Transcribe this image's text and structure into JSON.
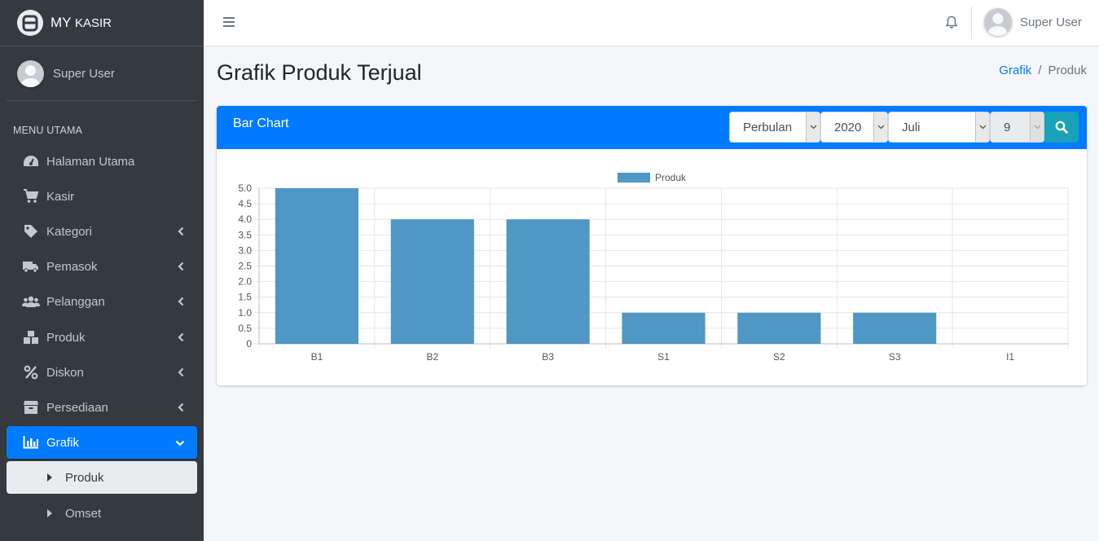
{
  "brand": {
    "name_main": "MY",
    "name_small": "KASIR"
  },
  "sidebar": {
    "user_name": "Super User",
    "menu_header": "MENU UTAMA",
    "items": [
      {
        "label": "Halaman Utama",
        "icon": "dashboard-icon",
        "has_children": false
      },
      {
        "label": "Kasir",
        "icon": "cart-icon",
        "has_children": false
      },
      {
        "label": "Kategori",
        "icon": "tag-icon",
        "has_children": true
      },
      {
        "label": "Pemasok",
        "icon": "truck-icon",
        "has_children": true
      },
      {
        "label": "Pelanggan",
        "icon": "users-icon",
        "has_children": true
      },
      {
        "label": "Produk",
        "icon": "boxes-icon",
        "has_children": true
      },
      {
        "label": "Diskon",
        "icon": "percent-icon",
        "has_children": true
      },
      {
        "label": "Persediaan",
        "icon": "box-icon",
        "has_children": true
      },
      {
        "label": "Grafik",
        "icon": "chart-bar-icon",
        "has_children": true,
        "active": true
      }
    ],
    "sub_items": [
      {
        "label": "Produk",
        "active": true
      },
      {
        "label": "Omset",
        "active": false
      }
    ]
  },
  "navbar": {
    "user_name": "Super User"
  },
  "page": {
    "title": "Grafik Produk Terjual",
    "breadcrumb": {
      "link": "Grafik",
      "separator": "/",
      "current": "Produk"
    }
  },
  "card": {
    "title": "Bar Chart",
    "filters": {
      "period": "Perbulan",
      "year": "2020",
      "month": "Juli",
      "day": "9"
    }
  },
  "colors": {
    "primary": "#007bff",
    "sidebar": "#343a40",
    "bar": "#4f97c4",
    "search": "#17a2b8"
  },
  "chart_data": {
    "type": "bar",
    "categories": [
      "B1",
      "B2",
      "B3",
      "S1",
      "S2",
      "S3",
      "I1"
    ],
    "series": [
      {
        "name": "Produk",
        "values": [
          5,
          4,
          4,
          1,
          1,
          1,
          0
        ]
      }
    ],
    "ylim": [
      0,
      5
    ],
    "yticks": [
      "0",
      "0.5",
      "1.0",
      "1.5",
      "2.0",
      "2.5",
      "3.0",
      "3.5",
      "4.0",
      "4.5",
      "5.0"
    ],
    "grid": true,
    "legend": "top-center"
  }
}
